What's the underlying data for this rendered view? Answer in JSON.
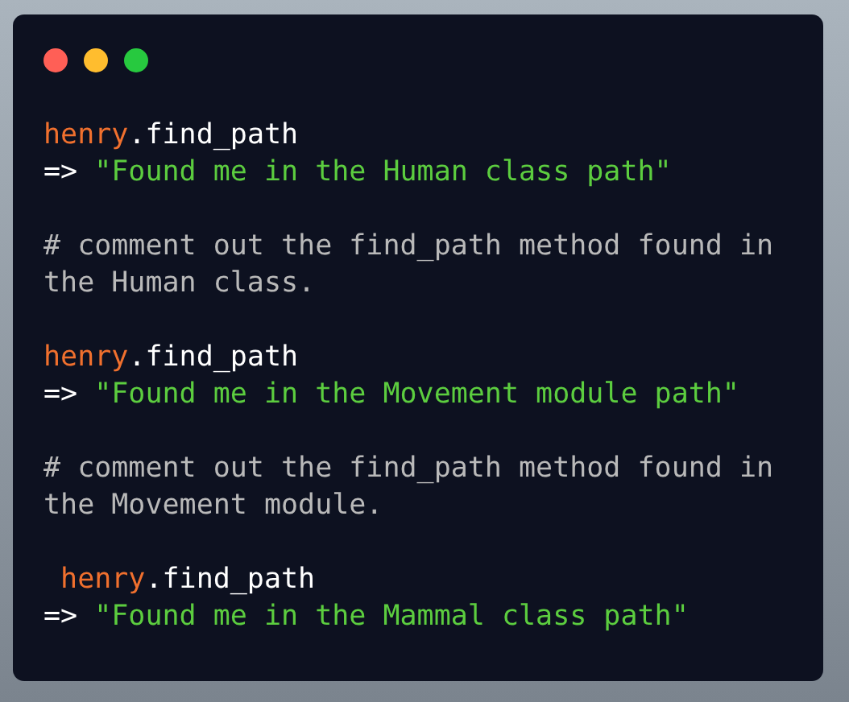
{
  "window_controls": [
    {
      "color": "#ff5f56"
    },
    {
      "color": "#ffbd2e"
    },
    {
      "color": "#27c93f"
    }
  ],
  "code_lines": [
    {
      "kind": "code",
      "tokens": [
        {
          "kind": "variable",
          "text": "henry"
        },
        {
          "kind": "plain",
          "text": ".find_path"
        }
      ]
    },
    {
      "kind": "code",
      "tokens": [
        {
          "kind": "plain",
          "text": "=> "
        },
        {
          "kind": "string",
          "text": "\"Found me in the Human class path\""
        }
      ]
    },
    {
      "kind": "blank"
    },
    {
      "kind": "code",
      "tokens": [
        {
          "kind": "comment",
          "text": "# comment out the find_path method found in"
        }
      ]
    },
    {
      "kind": "code",
      "tokens": [
        {
          "kind": "comment",
          "text": "the Human class."
        }
      ]
    },
    {
      "kind": "blank"
    },
    {
      "kind": "code",
      "tokens": [
        {
          "kind": "variable",
          "text": "henry"
        },
        {
          "kind": "plain",
          "text": ".find_path"
        }
      ]
    },
    {
      "kind": "code",
      "tokens": [
        {
          "kind": "plain",
          "text": "=> "
        },
        {
          "kind": "string",
          "text": "\"Found me in the Movement module path\""
        }
      ]
    },
    {
      "kind": "blank"
    },
    {
      "kind": "code",
      "tokens": [
        {
          "kind": "comment",
          "text": "# comment out the find_path method found in"
        }
      ]
    },
    {
      "kind": "code",
      "tokens": [
        {
          "kind": "comment",
          "text": "the Movement module."
        }
      ]
    },
    {
      "kind": "blank"
    },
    {
      "kind": "code",
      "tokens": [
        {
          "kind": "variable",
          "text": " henry"
        },
        {
          "kind": "plain",
          "text": ".find_path"
        }
      ]
    },
    {
      "kind": "code",
      "tokens": [
        {
          "kind": "plain",
          "text": "=> "
        },
        {
          "kind": "string",
          "text": "\"Found me in the Mammal class path\""
        }
      ]
    }
  ]
}
